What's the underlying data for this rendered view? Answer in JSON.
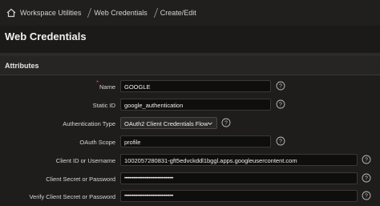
{
  "breadcrumb": {
    "items": [
      "Workspace Utilities",
      "Web Credentials",
      "Create/Edit"
    ]
  },
  "page": {
    "title": "Web Credentials"
  },
  "region": {
    "title": "Attributes"
  },
  "form": {
    "name": {
      "label": "Name",
      "value": "GOOGLE",
      "required_mark": "*"
    },
    "static_id": {
      "label": "Static ID",
      "value": "google_authentication"
    },
    "auth_type": {
      "label": "Authentication Type",
      "value": "OAuth2 Client Credentials Flow"
    },
    "oauth_scope": {
      "label": "OAuth Scope",
      "value": "profile"
    },
    "client_id": {
      "label": "Client ID or Username",
      "value": "1002057280831-gft5edvckddl1bggl.apps.googleusercontent.com"
    },
    "client_secret": {
      "label": "Client Secret or Password",
      "value": "••••••••••••••••••••••••••••••••••••••"
    },
    "verify_secret": {
      "label": "Verify Client Secret or Password",
      "value": "••••••••••••••••••••••••••••••••••••••"
    }
  },
  "icons": {
    "home": "home-icon",
    "help": "help-icon",
    "caret": "chevron-down-icon"
  },
  "colors": {
    "background": "#1b1a19",
    "field": "#0e0e0d",
    "required": "#e0463a"
  }
}
